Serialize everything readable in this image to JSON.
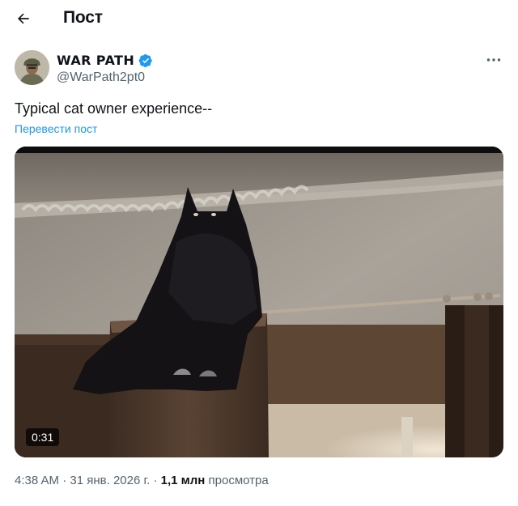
{
  "header": {
    "title": "Пост"
  },
  "author": {
    "display_name": "WAR PATH",
    "handle": "@WarPath2pt0",
    "verified": true
  },
  "tweet": {
    "text": "Typical cat owner experience--",
    "translate_label": "Перевести пост"
  },
  "media": {
    "type": "video",
    "duration": "0:31"
  },
  "meta": {
    "time": "4:38 AM",
    "separator": "·",
    "date": "31 янв. 2026 г.",
    "views_count": "1,1 млн",
    "views_label": "просмотра"
  },
  "colors": {
    "accent": "#1d9bf0",
    "text_secondary": "#536471",
    "verified": "#1d9bf0"
  },
  "icons": {
    "back": "arrow-left-icon",
    "verified": "verified-badge-icon",
    "more": "more-dots-icon"
  }
}
